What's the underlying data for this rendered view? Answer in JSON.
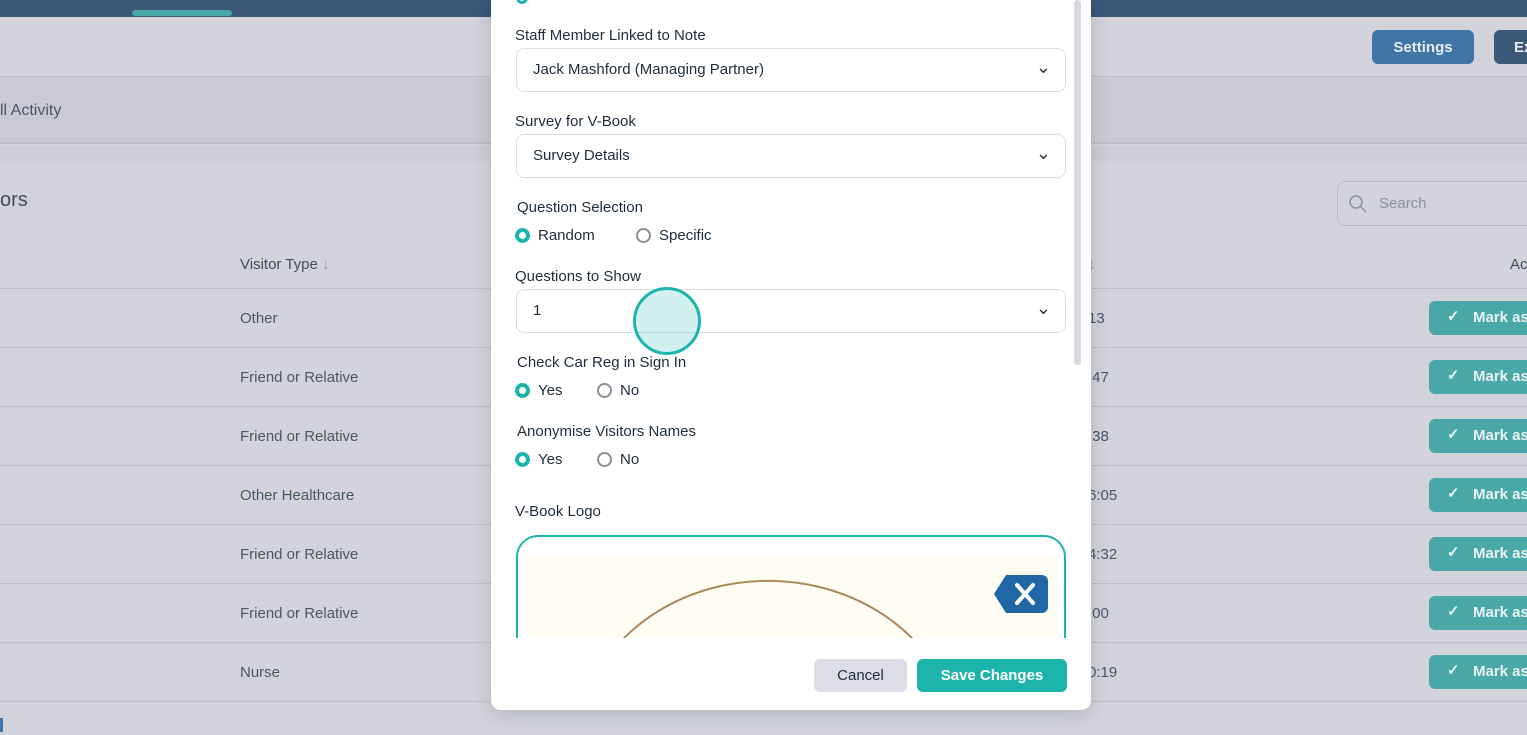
{
  "header": {
    "settings_label": "Settings",
    "export_label": "Ex"
  },
  "tabs": {
    "active": "ll Activity"
  },
  "section": {
    "title": "ors",
    "search_placeholder": "Search"
  },
  "table": {
    "columns": {
      "visitor_type": "Visitor Type",
      "actions": "Ac"
    },
    "rows": [
      {
        "visitor_type": "Other",
        "time": "13",
        "action": "Mark as"
      },
      {
        "visitor_type": "Friend or Relative",
        "time": ":47",
        "action": "Mark as"
      },
      {
        "visitor_type": "Friend or Relative",
        "time": ":38",
        "action": "Mark as"
      },
      {
        "visitor_type": "Other Healthcare",
        "time": "6:05",
        "action": "Mark as"
      },
      {
        "visitor_type": "Friend or Relative",
        "time": "4:32",
        "action": "Mark as"
      },
      {
        "visitor_type": "Friend or Relative",
        "time": ":00",
        "action": "Mark as"
      },
      {
        "visitor_type": "Nurse",
        "time": "0:19",
        "action": "Mark as"
      }
    ]
  },
  "modal": {
    "staff_label": "Staff Member Linked to Note",
    "staff_value": "Jack Mashford (Managing Partner)",
    "survey_label": "Survey for V-Book",
    "survey_value": "Survey Details",
    "qsel_label": "Question Selection",
    "qsel_options": [
      "Random",
      "Specific"
    ],
    "qshow_label": "Questions to Show",
    "qshow_value": "1",
    "car_label": "Check Car Reg in Sign In",
    "car_options": [
      "Yes",
      "No"
    ],
    "anon_label": "Anonymise Visitors Names",
    "anon_options": [
      "Yes",
      "No"
    ],
    "logo_label": "V-Book Logo",
    "cancel_label": "Cancel",
    "save_label": "Save Changes"
  },
  "colors": {
    "accent": "#1db5ab",
    "topbar": "#3b5878",
    "settings": "#3f76a6"
  }
}
